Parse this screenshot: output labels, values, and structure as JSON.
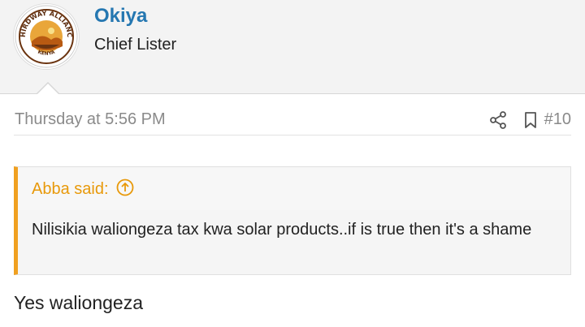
{
  "author": {
    "name": "Okiya",
    "title": "Chief Lister",
    "avatar": {
      "logo_top": "THIRDWAY ALLIANCE",
      "logo_bottom": "KENYA"
    }
  },
  "post": {
    "date": "Thursday at 5:56 PM",
    "number": "#10",
    "icons": [
      "share-icon",
      "bookmark-icon"
    ]
  },
  "quote": {
    "author_label": "Abba said:",
    "text": "Nilisikia waliongeza tax kwa solar products..if is true then it's a shame"
  },
  "reply": {
    "text": "Yes waliongeza"
  },
  "colors": {
    "link": "#2577b1",
    "quote_accent": "#f0a020",
    "muted": "#8a8a8a"
  }
}
